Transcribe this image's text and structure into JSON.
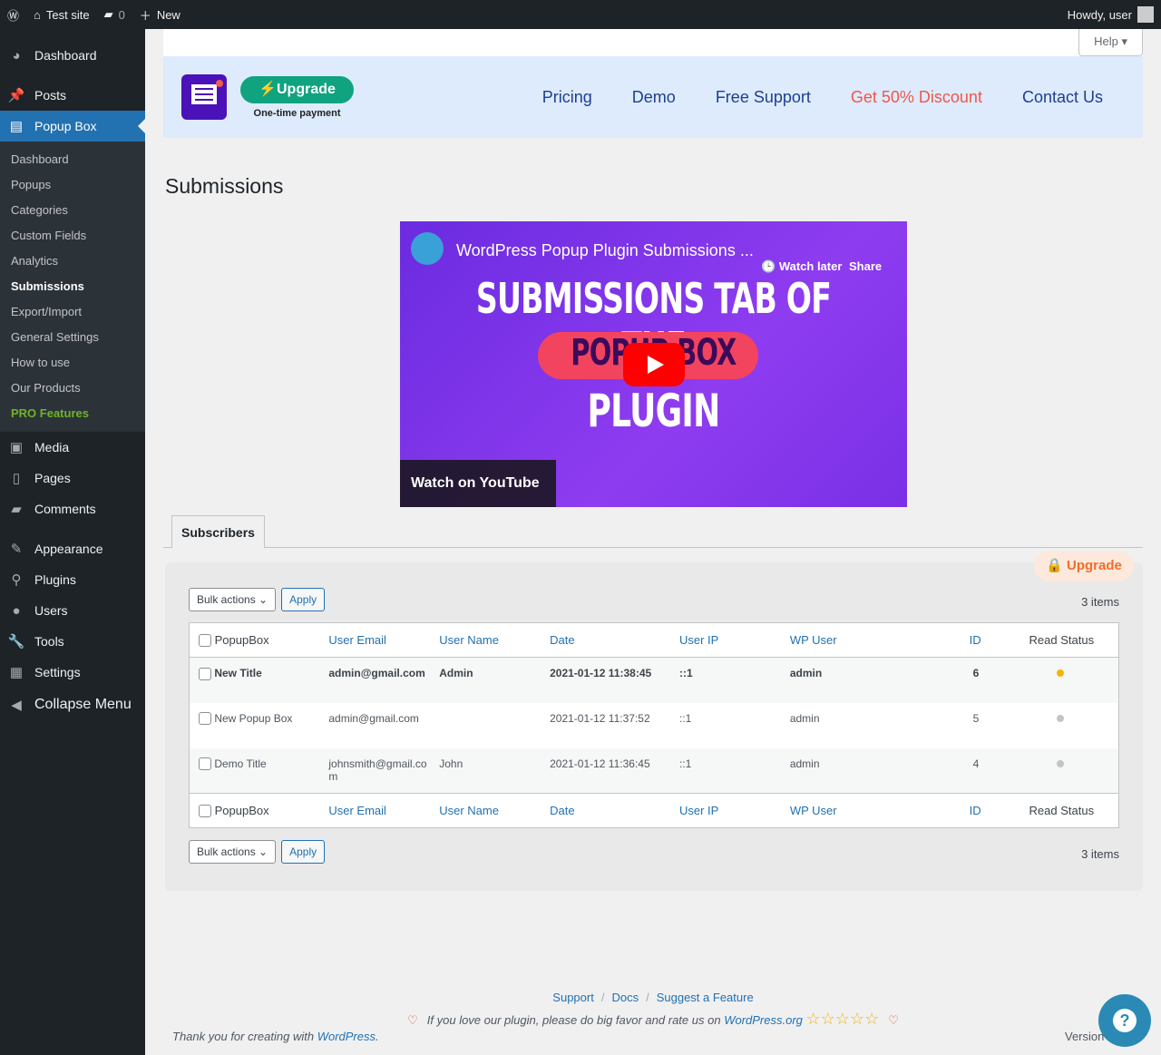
{
  "adminbar": {
    "site": "Test site",
    "comments": "0",
    "new": "New",
    "howdy": "Howdy, user"
  },
  "sidebar": {
    "items": [
      {
        "label": "Dashboard",
        "icon": "dashboard-icon"
      },
      {
        "label": "Posts",
        "icon": "pin-icon"
      },
      {
        "label": "Popup Box",
        "icon": "popup-icon"
      },
      {
        "label": "Media",
        "icon": "media-icon"
      },
      {
        "label": "Pages",
        "icon": "pages-icon"
      },
      {
        "label": "Comments",
        "icon": "comment-icon"
      },
      {
        "label": "Appearance",
        "icon": "brush-icon"
      },
      {
        "label": "Plugins",
        "icon": "plugin-icon"
      },
      {
        "label": "Users",
        "icon": "user-icon"
      },
      {
        "label": "Tools",
        "icon": "wrench-icon"
      },
      {
        "label": "Settings",
        "icon": "settings-icon"
      },
      {
        "label": "Collapse Menu",
        "icon": "collapse-icon"
      }
    ],
    "submenu": [
      "Dashboard",
      "Popups",
      "Categories",
      "Custom Fields",
      "Analytics",
      "Submissions",
      "Export/Import",
      "General Settings",
      "How to use",
      "Our Products",
      "PRO Features"
    ]
  },
  "header": {
    "help": "Help ▾",
    "upgrade": "Upgrade",
    "one_time": "One-time payment",
    "nav": [
      "Pricing",
      "Demo",
      "Free Support",
      "Get 50% Discount",
      "Contact Us"
    ]
  },
  "page_title": "Submissions",
  "video": {
    "title": "WordPress Popup Plugin Submissions ...",
    "watch_later": "Watch later",
    "share": "Share",
    "line1": "SUBMISSIONS TAB OF THE",
    "line2": "POPUP BOX",
    "line3": "PLUGIN",
    "watch_on": "Watch on YouTube"
  },
  "tab": "Subscribers",
  "upgrade2": "🔒 Upgrade",
  "bulk": "Bulk actions ⌄",
  "apply": "Apply",
  "items": "3 items",
  "columns": [
    "PopupBox",
    "User Email",
    "User Name",
    "Date",
    "User IP",
    "WP User",
    "ID",
    "Read Status"
  ],
  "rows": [
    {
      "title": "New Title",
      "email": "admin@gmail.com",
      "name": "Admin",
      "date": "2021-01-12 11:38:45",
      "ip": "::1",
      "wp": "admin",
      "id": "6",
      "read": false
    },
    {
      "title": "New Popup Box",
      "email": "admin@gmail.com",
      "name": "",
      "date": "2021-01-12 11:37:52",
      "ip": "::1",
      "wp": "admin",
      "id": "5",
      "read": true
    },
    {
      "title": "Demo Title",
      "email": "johnsmith@gmail.com",
      "name": "John",
      "date": "2021-01-12 11:36:45",
      "ip": "::1",
      "wp": "admin",
      "id": "4",
      "read": true
    }
  ],
  "colors": {
    "unread": "#f5b400",
    "read": "#c3c4c7",
    "accent": "#2271b1"
  },
  "footer": {
    "links": [
      "Support",
      "Docs",
      "Suggest a Feature"
    ],
    "rate_text": "If you love our plugin, please do big favor and rate us on",
    "rate_link": "WordPress.org",
    "thank": "Thank you for creating with",
    "wp": "WordPress",
    "version": "Version"
  }
}
